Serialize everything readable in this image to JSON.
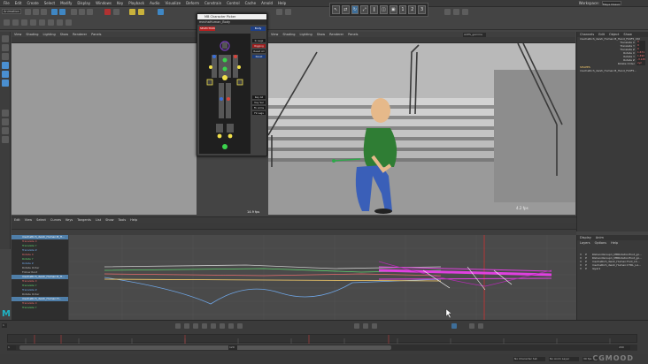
{
  "menubar": {
    "items": [
      "File",
      "Edit",
      "Create",
      "Select",
      "Modify",
      "Display",
      "Windows",
      "Key",
      "Playback",
      "Audio",
      "Visualize",
      "Deform",
      "Constrain",
      "Control",
      "Cache",
      "Arnold",
      "Help"
    ],
    "workspace_label": "Workspace:",
    "workspace_value": "Maya Classic"
  },
  "shelf": {
    "mode": "Animation"
  },
  "toolpanel": {
    "buttons": [
      "↖",
      "⇄",
      "↻",
      "⤢",
      "∥",
      "◫",
      "▣",
      "1",
      "2",
      "3"
    ]
  },
  "viewport_left": {
    "menu": [
      "View",
      "Shading",
      "Lighting",
      "Show",
      "Renderer",
      "Panels"
    ]
  },
  "picker": {
    "title": "MB Character Picker",
    "tab": "mechaHuman_Body",
    "selection_label": "SELECTION",
    "body_label": "Body",
    "side_buttons": [
      "Ik Legs",
      "Rigging",
      "Reset All",
      "Reset",
      "Key All",
      "Key Sel",
      "Fk Arms",
      "Fk Legs"
    ]
  },
  "viewport_main": {
    "menu": [
      "View",
      "Shading",
      "Lighting",
      "Show",
      "Renderer",
      "Panels"
    ],
    "fps_left": "14.9 fps",
    "fps_right": "4.2 fps",
    "camera_field": "ACES_gamma"
  },
  "channel_box": {
    "tabs": [
      "Channels",
      "Edit",
      "Object",
      "Show"
    ],
    "object_name": "mechaRich_dwsh_Human:B_Hand_Fk4F5_Ctrl",
    "attributes": [
      {
        "label": "Translate X",
        "value": "0"
      },
      {
        "label": "Translate Y",
        "value": "0"
      },
      {
        "label": "Translate Z",
        "value": "0"
      },
      {
        "label": "Rotate X",
        "value": "1.671"
      },
      {
        "label": "Rotate Y",
        "value": "1.492"
      },
      {
        "label": "Rotate Z",
        "value": "-3.145"
      },
      {
        "label": "Rotate Order",
        "value": "xyz"
      }
    ],
    "shapes_label": "SHAPES",
    "shape_name": "mechaRich_dwsh_Human:B_Hand_Fk4F5..."
  },
  "layers": {
    "tabs": [
      "Display",
      "Anim"
    ],
    "menu": [
      "Layers",
      "Options",
      "Help"
    ],
    "rows": [
      {
        "v": "V",
        "p": "P",
        "name": "RGhandGroup1_MBRotationFoot_go..."
      },
      {
        "v": "V",
        "p": "P",
        "name": "RGhandGroup1_MBRotationFoot_go..."
      },
      {
        "v": "V",
        "p": "P",
        "name": "mechaRich_dwsh_Human:Foot_LS..."
      },
      {
        "v": "V",
        "p": "P",
        "name": "mechaRich_dwsh_Human:CTRL_LA..."
      },
      {
        "v": "V",
        "p": "P",
        "name": "layer1"
      }
    ]
  },
  "graph_editor": {
    "menu": [
      "Edit",
      "View",
      "Select",
      "Curves",
      "Keys",
      "Tangents",
      "List",
      "Show",
      "Tools",
      "Help"
    ],
    "outliner_rows": [
      {
        "text": "mechaRich_dwsh_Human:B_H...",
        "cls": "sel"
      },
      {
        "text": "Translate X",
        "cls": "r"
      },
      {
        "text": "Translate Y",
        "cls": "g"
      },
      {
        "text": "Translate Z",
        "cls": "b"
      },
      {
        "text": "Rotate X",
        "cls": "r"
      },
      {
        "text": "Rotate Y",
        "cls": "g"
      },
      {
        "text": "Rotate Z",
        "cls": "b"
      },
      {
        "text": "Rotate Order",
        "cls": ""
      },
      {
        "text": "Follow Root",
        "cls": ""
      },
      {
        "text": "mechaRich_dwsh_Human:R_H...",
        "cls": "sel"
      },
      {
        "text": "Translate X",
        "cls": "r"
      },
      {
        "text": "Translate Y",
        "cls": "g"
      },
      {
        "text": "Translate Z",
        "cls": "b"
      },
      {
        "text": "Rotate Order",
        "cls": ""
      },
      {
        "text": "mechaRich_dwsh_Human:H...",
        "cls": "sel"
      },
      {
        "text": "Translate X",
        "cls": "r"
      },
      {
        "text": "Translate Y",
        "cls": "g"
      }
    ]
  },
  "timeline": {
    "current_frame": "1",
    "start": "1",
    "end": "120",
    "range_start": "1",
    "range_end": "120",
    "anim_end": "200",
    "character_label": "No Character Set",
    "anim_layer_label": "No Anim Layer",
    "fps_label": "30 fps"
  },
  "branding": {
    "logo": "M",
    "watermark": "CGMOOD"
  },
  "colors": {
    "accent_blue": "#4a8fd0",
    "picker_red": "#b62020",
    "curve_magenta": "#e040e0",
    "curve_green": "#5fd26e"
  }
}
